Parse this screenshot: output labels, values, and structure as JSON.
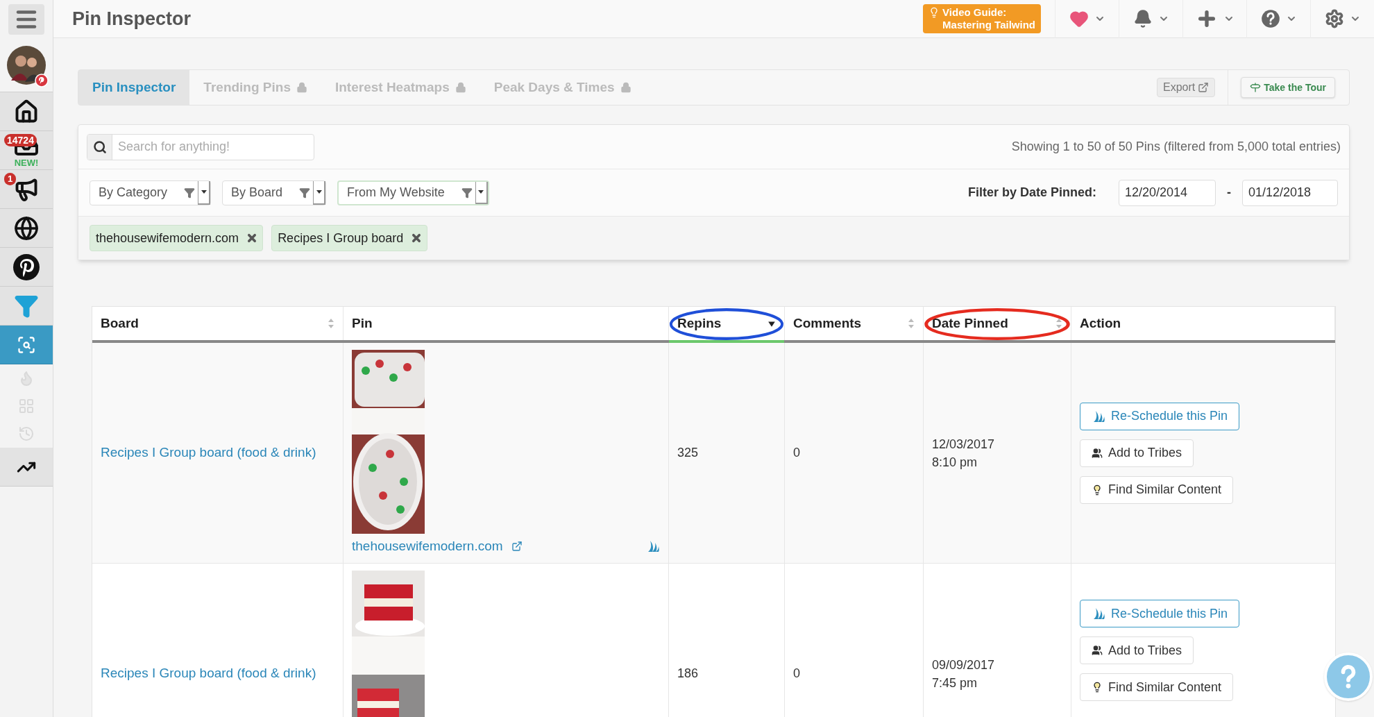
{
  "app": {
    "title": "Pin Inspector"
  },
  "sidebar": {
    "items": [
      {
        "selected": false,
        "disabled": false
      },
      {
        "badge": "14724",
        "note": "NEW!",
        "selected": false,
        "disabled": false
      },
      {
        "badge": "1",
        "selected": false,
        "disabled": false
      },
      {
        "selected": false,
        "disabled": false
      },
      {
        "selected": false,
        "disabled": false
      },
      {
        "selected": false,
        "disabled": false
      },
      {
        "selected": true,
        "disabled": false
      },
      {
        "selected": false,
        "disabled": true
      },
      {
        "selected": false,
        "disabled": true
      },
      {
        "selected": false,
        "disabled": true
      },
      {
        "selected": false,
        "disabled": false
      }
    ]
  },
  "topbar": {
    "video_guide": {
      "line1": "Video Guide:",
      "line2": "Mastering Tailwind"
    }
  },
  "tabs": [
    {
      "label": "Pin Inspector",
      "selected": true,
      "locked": false
    },
    {
      "label": "Trending Pins",
      "selected": false,
      "locked": true
    },
    {
      "label": "Interest Heatmaps",
      "selected": false,
      "locked": true
    },
    {
      "label": "Peak Days & Times",
      "selected": false,
      "locked": true
    }
  ],
  "export_button": "Export",
  "tour_button": "Take the Tour",
  "search": {
    "placeholder": "Search for anything!"
  },
  "summary": "Showing 1 to 50 of 50 Pins (filtered from 5,000 total entries)",
  "dropdowns": [
    {
      "label": "By Category",
      "active": false
    },
    {
      "label": "By Board",
      "active": false
    },
    {
      "label": "From My Website",
      "active": true
    }
  ],
  "date_filter": {
    "label": "Filter by Date Pinned:",
    "from": "12/20/2014",
    "separator": "-",
    "to": "01/12/2018"
  },
  "chips": [
    "thehousewifemodern.com",
    "Recipes I Group board"
  ],
  "table": {
    "columns": [
      {
        "label": "Board",
        "sortable": true,
        "sorted": false
      },
      {
        "label": "Pin",
        "sortable": false,
        "sorted": false
      },
      {
        "label": "Repins",
        "sortable": true,
        "sorted": true,
        "annotation": {
          "color": "#1f4fd8"
        }
      },
      {
        "label": "Comments",
        "sortable": true,
        "sorted": false
      },
      {
        "label": "Date Pinned",
        "sortable": true,
        "sorted": false,
        "annotation": {
          "color": "#e52b1f"
        }
      },
      {
        "label": "Action",
        "sortable": false,
        "sorted": false
      }
    ],
    "rows": [
      {
        "board": "Recipes I Group board (food & drink)",
        "source": "thehousewifemodern.com",
        "repins": "325",
        "comments": "0",
        "date": "12/03/2017",
        "time": "8:10 pm",
        "actions": [
          {
            "kind": "reschedule",
            "label": "Re-Schedule this Pin"
          },
          {
            "kind": "tribes",
            "label": "Add to Tribes"
          },
          {
            "kind": "similar",
            "label": "Find Similar Content"
          }
        ]
      },
      {
        "board": "Recipes I Group board (food & drink)",
        "repins": "186",
        "comments": "0",
        "date": "09/09/2017",
        "time": "7:45 pm",
        "actions": [
          {
            "kind": "reschedule",
            "label": "Re-Schedule this Pin"
          },
          {
            "kind": "tribes",
            "label": "Add to Tribes"
          },
          {
            "kind": "similar",
            "label": "Find Similar Content"
          }
        ]
      }
    ]
  }
}
